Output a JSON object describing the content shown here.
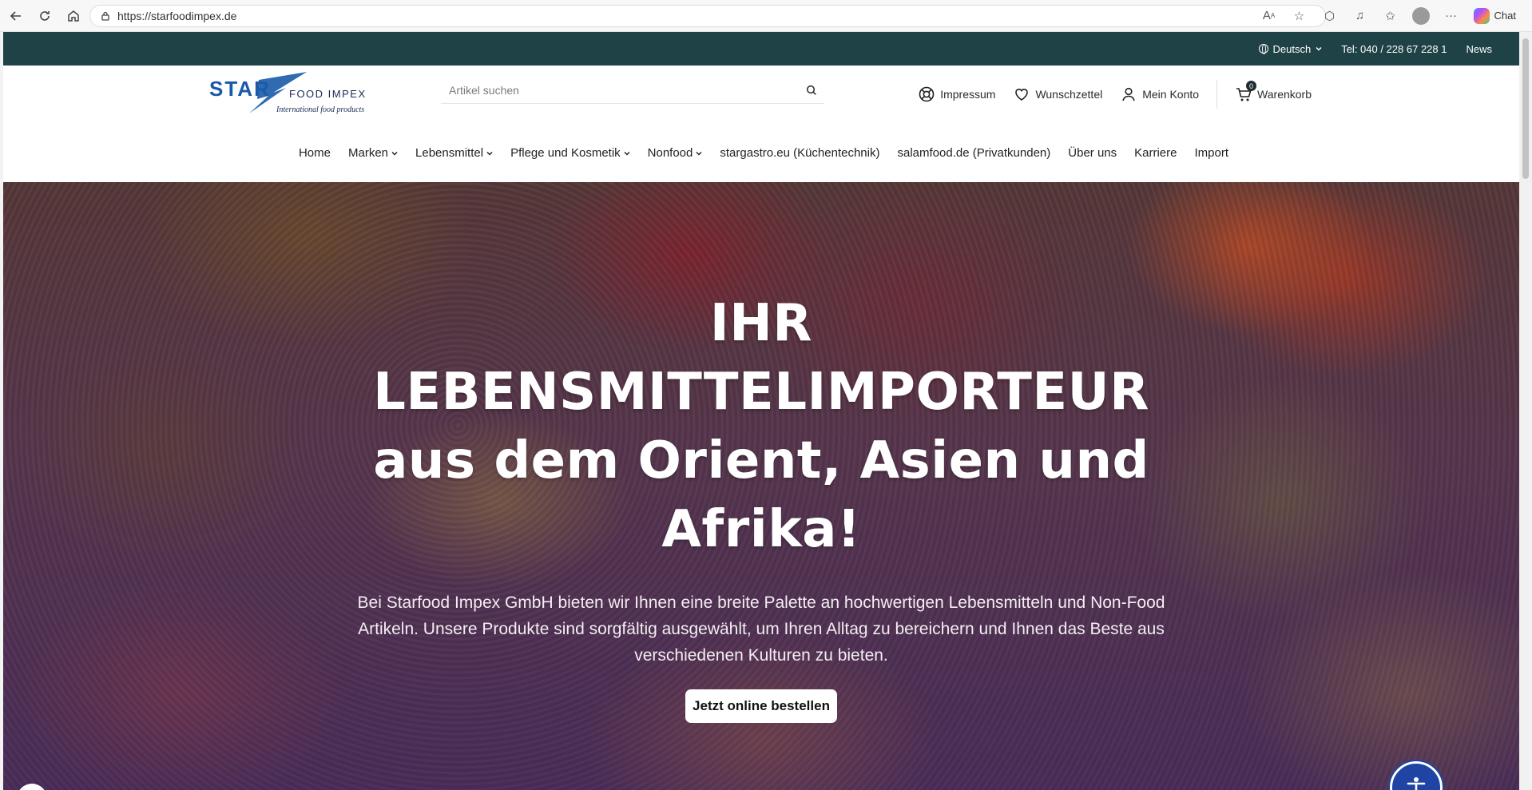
{
  "browser": {
    "url": "https://starfoodimpex.de",
    "chat_label": "Chat"
  },
  "topbar": {
    "language": "Deutsch",
    "phone": "Tel: 040 / 228 67 228 1",
    "news": "News"
  },
  "header": {
    "logo_brand": "STARFOOD IMPEX",
    "logo_tagline": "International food products",
    "search_placeholder": "Artikel suchen",
    "links": {
      "impressum": "Impressum",
      "wishlist": "Wunschzettel",
      "account": "Mein Konto",
      "cart": "Warenkorb",
      "cart_count": "0"
    }
  },
  "mainnav": {
    "home": "Home",
    "marken": "Marken",
    "lebensmittel": "Lebensmittel",
    "pflege": "Pflege und Kosmetik",
    "nonfood": "Nonfood",
    "stargastro": "stargastro.eu (Küchentechnik)",
    "salamfood": "salamfood.de (Privatkunden)",
    "about": "Über uns",
    "karriere": "Karriere",
    "import": "Import"
  },
  "hero": {
    "title": "IHR LEBENSMITTELIMPORTEUR aus dem Orient, Asien und Afrika!",
    "text": "Bei Starfood Impex GmbH bieten wir Ihnen eine breite Palette an hochwertigen Lebensmitteln und Non-Food Artikeln. Unsere Produkte sind sorgfältig ausgewählt, um Ihren Alltag zu bereichern und Ihnen das Beste aus verschiedenen Kulturen zu bieten.",
    "cta": "Jetzt online bestellen"
  },
  "colors": {
    "topbar_bg": "#1f4246",
    "logo_blue": "#1a5aa8",
    "accessibility_blue": "#1f44a3"
  }
}
